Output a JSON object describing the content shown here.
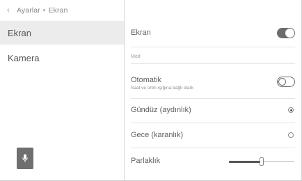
{
  "breadcrumb": {
    "back_icon": "chevron-left-icon",
    "parent": "Ayarlar",
    "separator": "•",
    "current": "Ekran"
  },
  "sidebar": {
    "items": [
      {
        "label": "Ekran",
        "active": true
      },
      {
        "label": "Kamera",
        "active": false
      }
    ],
    "voice_button_icon": "microphone-icon"
  },
  "main": {
    "screen_toggle": {
      "label": "Ekran",
      "on": true
    },
    "mode_section": {
      "label": "Mod"
    },
    "auto_toggle": {
      "label": "Otomatik",
      "description": "Saat ve ortm ışığına bağlı olark",
      "on": false
    },
    "day_option": {
      "label": "Gündüz (aydınlık)",
      "selected": true
    },
    "night_option": {
      "label": "Gece (karanlık)",
      "selected": false
    },
    "brightness": {
      "label": "Parlaklık",
      "level": 0.5
    }
  },
  "colors": {
    "active_item_bg": "#ececec",
    "toggle_on": "#6c6c6c",
    "text": "#5a5a5a",
    "voice_button": "#6f6f6f"
  }
}
